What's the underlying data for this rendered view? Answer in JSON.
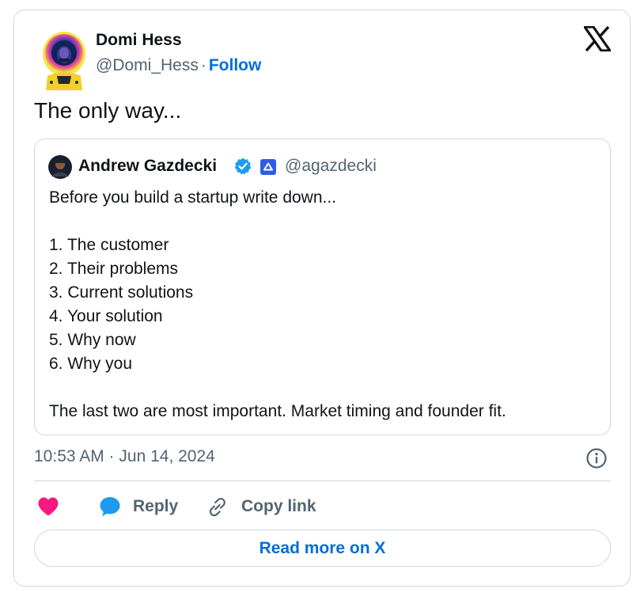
{
  "author": {
    "name": "Domi Hess",
    "handle": "@Domi_Hess",
    "separator": "·",
    "follow_label": "Follow",
    "avatar_icon": "astronaut-avatar"
  },
  "brand_icon": "x-logo-icon",
  "tweet": {
    "text": "The only way..."
  },
  "quoted_tweet": {
    "author_name": "Andrew Gazdecki",
    "handle": "@agazdecki",
    "verified_icon": "verified-badge-icon",
    "affiliation_icon": "affiliate-badge-icon",
    "body_lines": [
      "Before you build a startup write down...",
      "",
      "1. The customer",
      "2. Their problems",
      "3. Current solutions",
      "4. Your solution",
      "5. Why now",
      "6. Why you",
      "",
      "The last two are most important. Market timing and founder fit."
    ]
  },
  "timestamp": "10:53 AM · Jun 14, 2024",
  "actions": {
    "reply_label": "Reply",
    "copy_label": "Copy link"
  },
  "read_more_label": "Read more on X",
  "colors": {
    "accent": "#006fd6",
    "heart": "#f91880",
    "reply": "#1d9bf0",
    "muted": "#536471",
    "border": "#cfd9de",
    "verified": "#1d9bf0"
  }
}
